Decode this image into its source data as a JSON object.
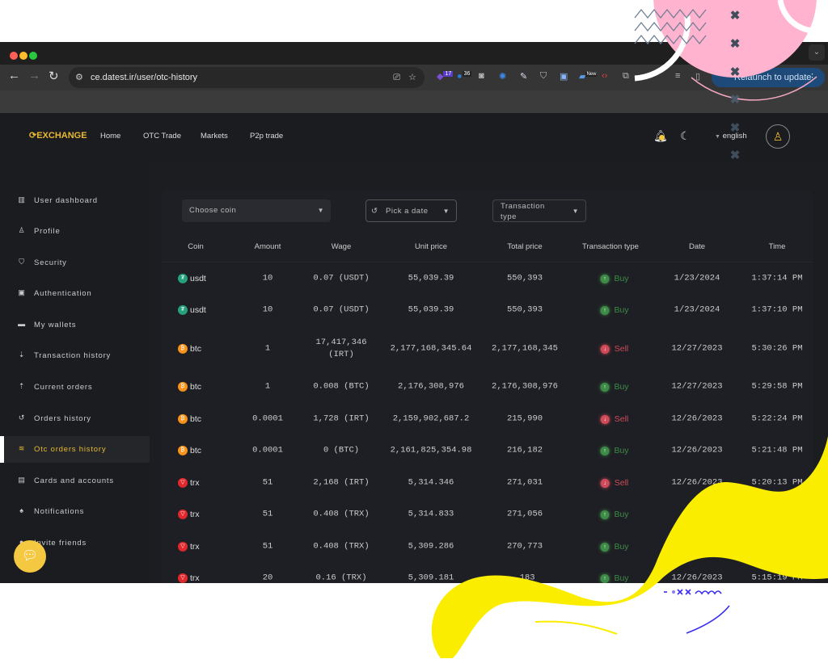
{
  "browser": {
    "url": "ce.datest.ir/user/otc-history",
    "extension_badges": [
      "17",
      "36",
      "New"
    ],
    "relaunch_label": "Relaunch to update"
  },
  "header": {
    "logo": "EXCHANGE",
    "nav": [
      "Home",
      "OTC Trade",
      "Markets",
      "P2p trade"
    ],
    "language": "english"
  },
  "sidebar": {
    "items": [
      {
        "label": "User dashboard",
        "icon": "dashboard-icon",
        "glyph": "▥"
      },
      {
        "label": "Profile",
        "icon": "user-icon",
        "glyph": "♙"
      },
      {
        "label": "Security",
        "icon": "shield-icon",
        "glyph": "⛉"
      },
      {
        "label": "Authentication",
        "icon": "id-badge-icon",
        "glyph": "▣"
      },
      {
        "label": "My wallets",
        "icon": "wallet-icon",
        "glyph": "▬"
      },
      {
        "label": "Transaction history",
        "icon": "sort-down-icon",
        "glyph": "⇣"
      },
      {
        "label": "Current orders",
        "icon": "sort-up-icon",
        "glyph": "⇡"
      },
      {
        "label": "Orders history",
        "icon": "history-icon",
        "glyph": "↺"
      },
      {
        "label": "Otc orders history",
        "icon": "layers-icon",
        "glyph": "≋",
        "active": true
      },
      {
        "label": "Cards and accounts",
        "icon": "card-icon",
        "glyph": "▤"
      },
      {
        "label": "Notifications",
        "icon": "bell-icon",
        "glyph": "♠"
      },
      {
        "label": "Invite friends",
        "icon": "invite-icon",
        "glyph": "●"
      }
    ]
  },
  "filters": {
    "coin": "Choose coin",
    "date": "Pick a date",
    "type": "Transaction type"
  },
  "table": {
    "columns": [
      "Coin",
      "Amount",
      "Wage",
      "Unit price",
      "Total price",
      "Transaction type",
      "Date",
      "Time"
    ],
    "rows": [
      {
        "coin": "usdt",
        "amount": "10",
        "wage": "0.07 (USDT)",
        "unit": "55,039.39",
        "total": "550,393",
        "type": "Buy",
        "date": "1/23/2024",
        "time": "1:37:14 PM"
      },
      {
        "coin": "usdt",
        "amount": "10",
        "wage": "0.07 (USDT)",
        "unit": "55,039.39",
        "total": "550,393",
        "type": "Buy",
        "date": "1/23/2024",
        "time": "1:37:10 PM"
      },
      {
        "coin": "btc",
        "amount": "1",
        "wage": "17,417,346 (IRT)",
        "unit": "2,177,168,345.64",
        "total": "2,177,168,345",
        "type": "Sell",
        "date": "12/27/2023",
        "time": "5:30:26 PM"
      },
      {
        "coin": "btc",
        "amount": "1",
        "wage": "0.008 (BTC)",
        "unit": "2,176,308,976",
        "total": "2,176,308,976",
        "type": "Buy",
        "date": "12/27/2023",
        "time": "5:29:58 PM"
      },
      {
        "coin": "btc",
        "amount": "0.0001",
        "wage": "1,728 (IRT)",
        "unit": "2,159,902,687.2",
        "total": "215,990",
        "type": "Sell",
        "date": "12/26/2023",
        "time": "5:22:24 PM"
      },
      {
        "coin": "btc",
        "amount": "0.0001",
        "wage": "0 (BTC)",
        "unit": "2,161,825,354.98",
        "total": "216,182",
        "type": "Buy",
        "date": "12/26/2023",
        "time": "5:21:48 PM"
      },
      {
        "coin": "trx",
        "amount": "51",
        "wage": "2,168 (IRT)",
        "unit": "5,314.346",
        "total": "271,031",
        "type": "Sell",
        "date": "12/26/2023",
        "time": "5:20:13 PM"
      },
      {
        "coin": "trx",
        "amount": "51",
        "wage": "0.408 (TRX)",
        "unit": "5,314.833",
        "total": "271,056",
        "type": "Buy",
        "date": "",
        "time": ""
      },
      {
        "coin": "trx",
        "amount": "51",
        "wage": "0.408 (TRX)",
        "unit": "5,309.286",
        "total": "270,773",
        "type": "Buy",
        "date": "",
        "time": ""
      },
      {
        "coin": "trx",
        "amount": "20",
        "wage": "0.16 (TRX)",
        "unit": "5,309.181",
        "total": "…183",
        "type": "Buy",
        "date": "12/26/2023",
        "time": "5:15:19 PM"
      }
    ]
  },
  "colors": {
    "accent": "#e8b931",
    "buy": "#3d8b46",
    "sell": "#d04a5a",
    "usdt": "#26a17b",
    "btc": "#f7931a",
    "trx": "#e0282e",
    "pink_deco": "#ffb3cf",
    "yellow_deco": "#fbed00",
    "blue_deco": "#3a2cf0"
  }
}
